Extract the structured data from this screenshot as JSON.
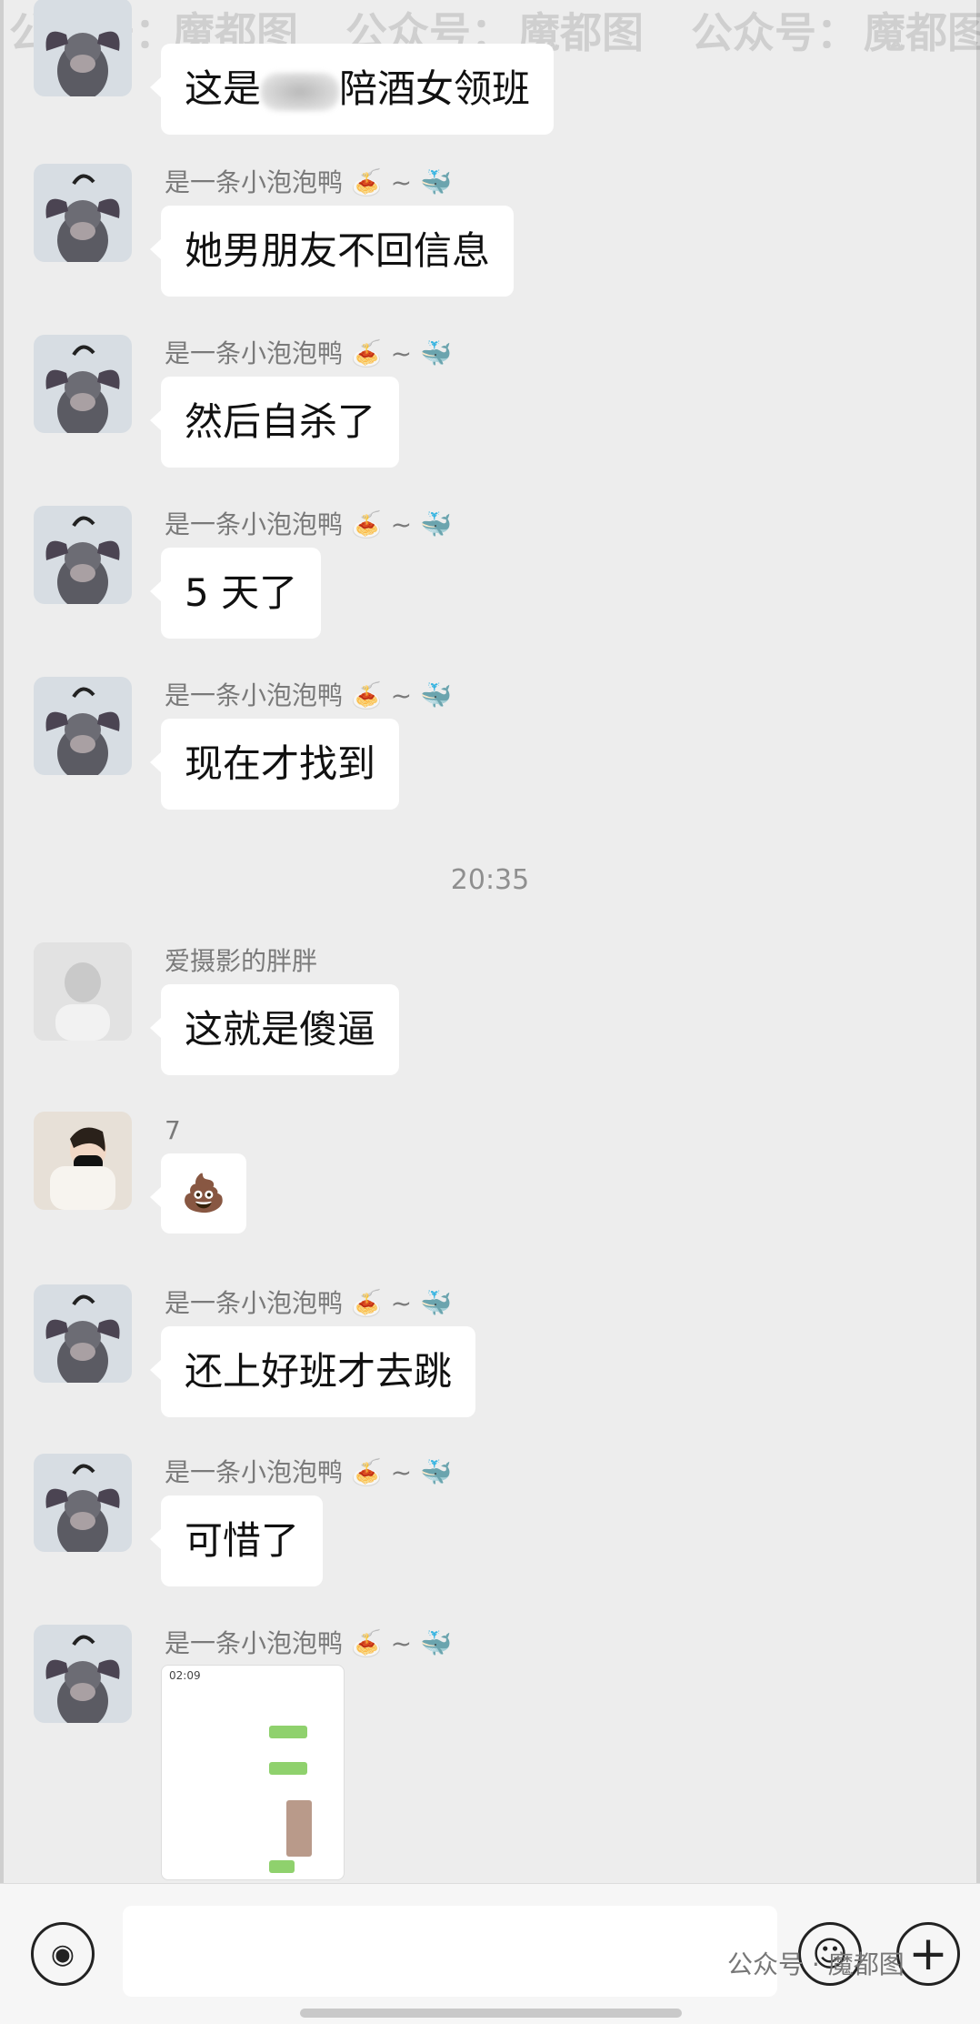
{
  "watermark": {
    "text1": "公众号：",
    "text2": "魔都图"
  },
  "messages": [
    {
      "sender": "",
      "text_before": "这是",
      "text_after": "陪酒女领班"
    },
    {
      "sender": "是一条小泡泡鸭 🍝 ~ 🐳",
      "text": "她男朋友不回信息"
    },
    {
      "sender": "是一条小泡泡鸭 🍝 ~ 🐳",
      "text": "然后自杀了"
    },
    {
      "sender": "是一条小泡泡鸭 🍝 ~ 🐳",
      "text": "5 天了"
    },
    {
      "sender": "是一条小泡泡鸭 🍝 ~ 🐳",
      "text": "现在才找到"
    },
    {
      "sender": "爱摄影的胖胖",
      "text": "这就是傻逼"
    },
    {
      "sender": "7",
      "text": "💩"
    },
    {
      "sender": "是一条小泡泡鸭 🍝 ~ 🐳",
      "text": "还上好班才去跳"
    },
    {
      "sender": "是一条小泡泡鸭 🍝 ~ 🐳",
      "text": "可惜了"
    },
    {
      "sender": "是一条小泡泡鸭 🍝 ~ 🐳",
      "text": ""
    }
  ],
  "timestamp": "20:35",
  "footer": "公众号 · 魔都图",
  "icons": {
    "voice": "voice-icon",
    "emoji": "emoji-icon",
    "plus": "plus-icon"
  }
}
